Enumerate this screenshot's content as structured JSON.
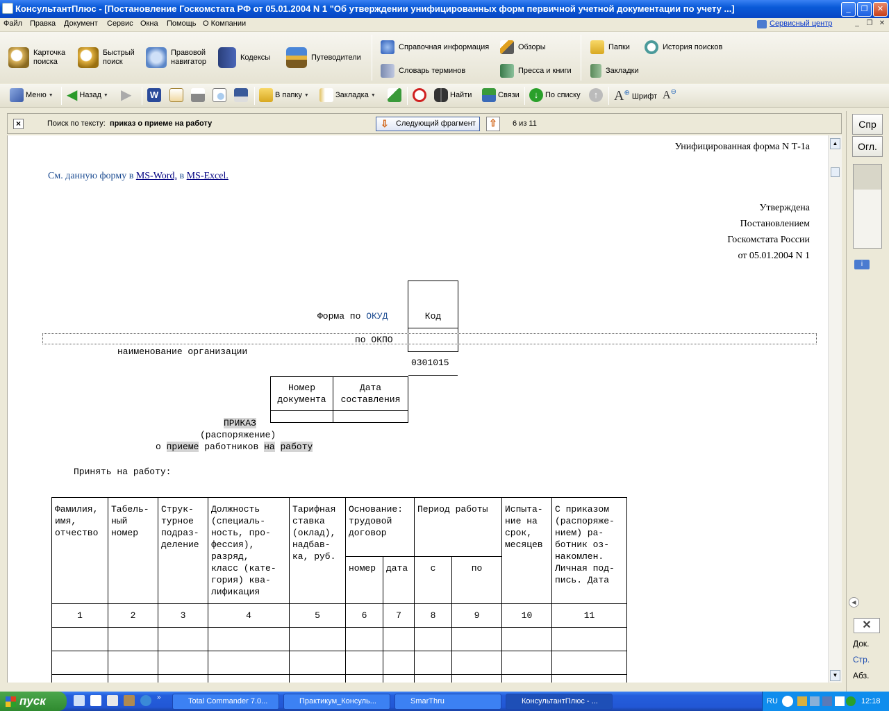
{
  "window": {
    "title": "КонсультантПлюс - [Постановление Госкомстата РФ от 05.01.2004 N 1 \"Об утверждении унифицированных форм первичной учетной документации по учету ...]"
  },
  "menubar": {
    "items": [
      "Файл",
      "Правка",
      "Документ",
      "Сервис",
      "Окна",
      "Помощь",
      "О Компании"
    ],
    "service_center": "Сервисный центр"
  },
  "bigtoolbar": {
    "card_search": "Карточка поиска",
    "quick_search": "Быстрый поиск",
    "legal_navigator": "Правовой навигатор",
    "codes": "Кодексы",
    "guides": "Путеводители",
    "reference": "Справочная информация",
    "reviews": "Обзоры",
    "glossary": "Словарь терминов",
    "press": "Пресса и книги",
    "folders": "Папки",
    "history": "История поисков",
    "bookmarks": "Закладки"
  },
  "toolbar": {
    "menu": "Меню",
    "back": "Назад",
    "to_folder": "В папку",
    "bookmark": "Закладка",
    "find": "Найти",
    "links": "Связи",
    "by_list": "По списку",
    "font": "Шрифт"
  },
  "searchbar": {
    "label": "Поиск по тексту:",
    "query": "приказ о приеме на работу",
    "next_button": "Следующий фрагмент",
    "counter": "6 из 11"
  },
  "document": {
    "form_name": "Унифицированная форма N Т-1а",
    "see_prefix": "См. данную форму в",
    "ms_word": "MS-Word,",
    "in_word": "в",
    "ms_excel": "MS-Excel.",
    "approved": [
      "Утверждена",
      "Постановлением",
      "Госкомстата России",
      "от 05.01.2004 N 1"
    ],
    "code_header": "Код",
    "okud_prefix": "Форма по",
    "okud_label": "ОКУД",
    "okud_code": "0301015",
    "okpo_label": "по ОКПО",
    "org_name": "наименование организации",
    "doc_number_header": "Номер\nдокумента",
    "doc_date_header": "Дата\nсоставления",
    "order_title": "ПРИКАЗ",
    "order_subtitle": "(распоряжение)",
    "order_line": {
      "o": "о",
      "priem": "приеме",
      "workers": "работников",
      "na": "на",
      "work": "работу"
    },
    "accept": "Принять на работу:",
    "table": {
      "headers": {
        "c1": "Фамилия,\nимя,\nотчество",
        "c2": "Табель-\nный\nномер",
        "c3": "Струк-\nтурное\nподраз-\nделение",
        "c4": "Должность\n(специаль-\nность, про-\nфессия),\nразряд,\nкласс (кате-\nгория) ква-\nлификация",
        "c5": "Тарифная\nставка\n(оклад),\nнадбав-\nка, руб.",
        "c6": "Основание:\nтрудовой\nдоговор",
        "c6a": "номер",
        "c6b": "дата",
        "c7": "Период работы",
        "c7a": "с",
        "c7b": "по",
        "c8": "Испыта-\nние на\nсрок,\nмесяцев",
        "c9": "С приказом\n(распоряже-\nнием) ра-\nботник оз-\nнакомлен.\nЛичная под-\nпись. Дата"
      },
      "numbers": [
        "1",
        "2",
        "3",
        "4",
        "5",
        "6",
        "7",
        "8",
        "9",
        "10",
        "11"
      ]
    }
  },
  "rightpanel": {
    "tab1": "Спр",
    "tab2": "Огл.",
    "doc": "Док.",
    "page": "Стр.",
    "para": "Абз."
  },
  "taskbar": {
    "start": "пуск",
    "tasks": [
      "Total Commander 7.0...",
      "Практикум_Консуль...",
      "SmarThru",
      "КонсультантПлюс - ..."
    ],
    "lang": "RU",
    "clock": "12:18"
  },
  "colors": {
    "title_blue": "#0a5ad8",
    "link": "#000080",
    "highlight": "#d4d4d4",
    "start_green": "#2f8a2f"
  }
}
